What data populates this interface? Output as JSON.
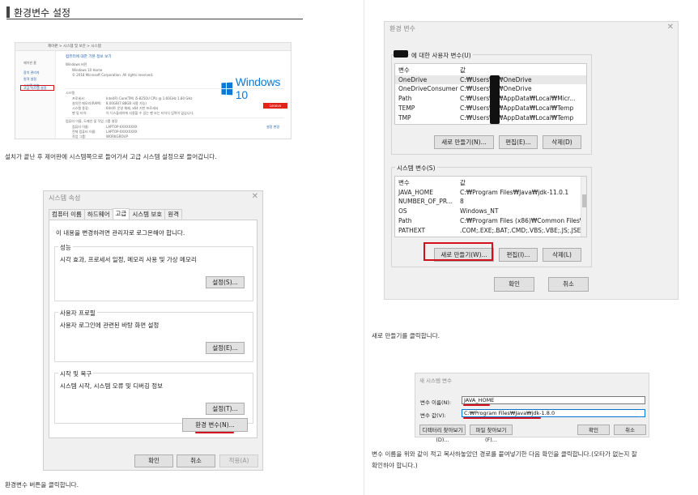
{
  "section_title": "환경변수 설정",
  "control_panel": {
    "breadcrumb": "제어판  >  시스템 및 보안  >  시스템",
    "side_title": "제어판 홈",
    "side_links": [
      "장치 관리자",
      "원격 설정",
      "시스템 보호",
      "고급 시스템 설정"
    ],
    "heading": "컴퓨터에 대한 기본 정보 보기",
    "edition_label": "Windows 버전",
    "edition": "Windows 10 Home",
    "copyright": "© 2018 Microsoft Corporation. All rights reserved.",
    "system_label": "시스템",
    "rows": [
      {
        "k": "프로세서:",
        "v": "Intel(R) Core(TM) i5-8250U CPU @ 1.60GHz   1.80 GHz"
      },
      {
        "k": "설치된 메모리(RAM):",
        "v": "8.00GB(7.88GB 사용 가능)"
      },
      {
        "k": "시스템 종류:",
        "v": "64비트 운영 체제, x64 기반 프로세서"
      },
      {
        "k": "펜 및 터치:",
        "v": "이 디스플레이에 사용할 수 있는 펜 또는 터치식 입력이 없습니다."
      }
    ],
    "name_section": "컴퓨터 이름, 도메인 및 작업 그룹 설정",
    "name_rows": [
      {
        "k": "컴퓨터 이름:",
        "v": "LAPTOP-XXXXXXXX"
      },
      {
        "k": "전체 컴퓨터 이름:",
        "v": "LAPTOP-XXXXXXXX"
      },
      {
        "k": "작업 그룹:",
        "v": "WORKGROUP"
      }
    ],
    "change_link": "설정 변경",
    "brand": "Windows 10",
    "oem": "Lenovo"
  },
  "caption1": "설치가 끝난 후 제어판에 시스템쪽으로 들어가서 고급 시스템 설정으로 들어갑니다.",
  "sysprops": {
    "title": "시스템 속성",
    "tabs": [
      "컴퓨터 이름",
      "하드웨어",
      "고급",
      "시스템 보호",
      "원격"
    ],
    "admin_note": "이 내용을 변경하려면 관리자로 로그온해야 합니다.",
    "groups": [
      {
        "label": "성능",
        "desc": "시각 효과, 프로세서 일정, 메모리 사용 및 가상 메모리",
        "btn": "설정(S)..."
      },
      {
        "label": "사용자 프로필",
        "desc": "사용자 로그인에 관련된 바탕 화면 설정",
        "btn": "설정(E)..."
      },
      {
        "label": "시작 및 복구",
        "desc": "시스템 시작, 시스템 오류 및 디버깅 정보",
        "btn": "설정(T)..."
      }
    ],
    "env_btn": "환경 변수(N)...",
    "ok": "확인",
    "cancel": "취소",
    "apply": "적용(A)"
  },
  "caption2": "환경변수 버튼을 클릭합니다.",
  "envvars": {
    "title": "환경 변수",
    "user_group": "에 대한 사용자 변수(U)",
    "col_var": "변수",
    "col_val": "값",
    "user_rows": [
      {
        "name": "OneDrive",
        "value": "C:₩Users₩        ₩OneDrive"
      },
      {
        "name": "OneDriveConsumer",
        "value": "C:₩Users₩        ₩OneDrive"
      },
      {
        "name": "Path",
        "value": "C:₩Users₩        ₩AppData₩Local₩Micr..."
      },
      {
        "name": "TEMP",
        "value": "C:₩Users₩        ₩AppData₩Local₩Temp"
      },
      {
        "name": "TMP",
        "value": "C:₩Users₩        ₩AppData₩Local₩Temp"
      }
    ],
    "user_btns": [
      "새로 만들기(N)...",
      "편집(E)...",
      "삭제(D)"
    ],
    "sys_group": "시스템 변수(S)",
    "sys_rows": [
      {
        "name": "JAVA_HOME",
        "value": "C:₩Program Files₩Java₩jdk-11.0.1"
      },
      {
        "name": "NUMBER_OF_PR...",
        "value": "8"
      },
      {
        "name": "OS",
        "value": "Windows_NT"
      },
      {
        "name": "Path",
        "value": "C:₩Program Files (x86)₩Common Files₩..."
      },
      {
        "name": "PATHEXT",
        "value": ".COM;.EXE;.BAT;.CMD;.VBS;.VBE;.JS;.JSE;.W..."
      }
    ],
    "sys_btns": [
      "새로 만들기(W)...",
      "편집(I)...",
      "삭제(L)"
    ],
    "ok": "확인",
    "cancel": "취소"
  },
  "caption3": "새로 만들기를 클릭합니다.",
  "newvar": {
    "title": "새 시스템 변수",
    "name_label": "변수 이름(N):",
    "name_value": "JAVA_HOME",
    "value_label": "변수 값(V):",
    "value_value": "C:₩Program Files₩Java₩jdk-1.8.0",
    "browse_dir": "디렉터리 찾아보기(D)...",
    "browse_file": "파일 찾아보기(F)...",
    "ok": "확인",
    "cancel": "취소"
  },
  "caption4_line1": "변수 이름을 위와 같이 적고 복사하놓았던 경로를 붙여넣기한 다음 확인을 클릭합니다.(오타가 없는지 잘",
  "caption4_line2": "확인하야 합니다.)",
  "colors": {
    "accent_red": "#d0101d",
    "win_blue": "#0a7ad6"
  }
}
